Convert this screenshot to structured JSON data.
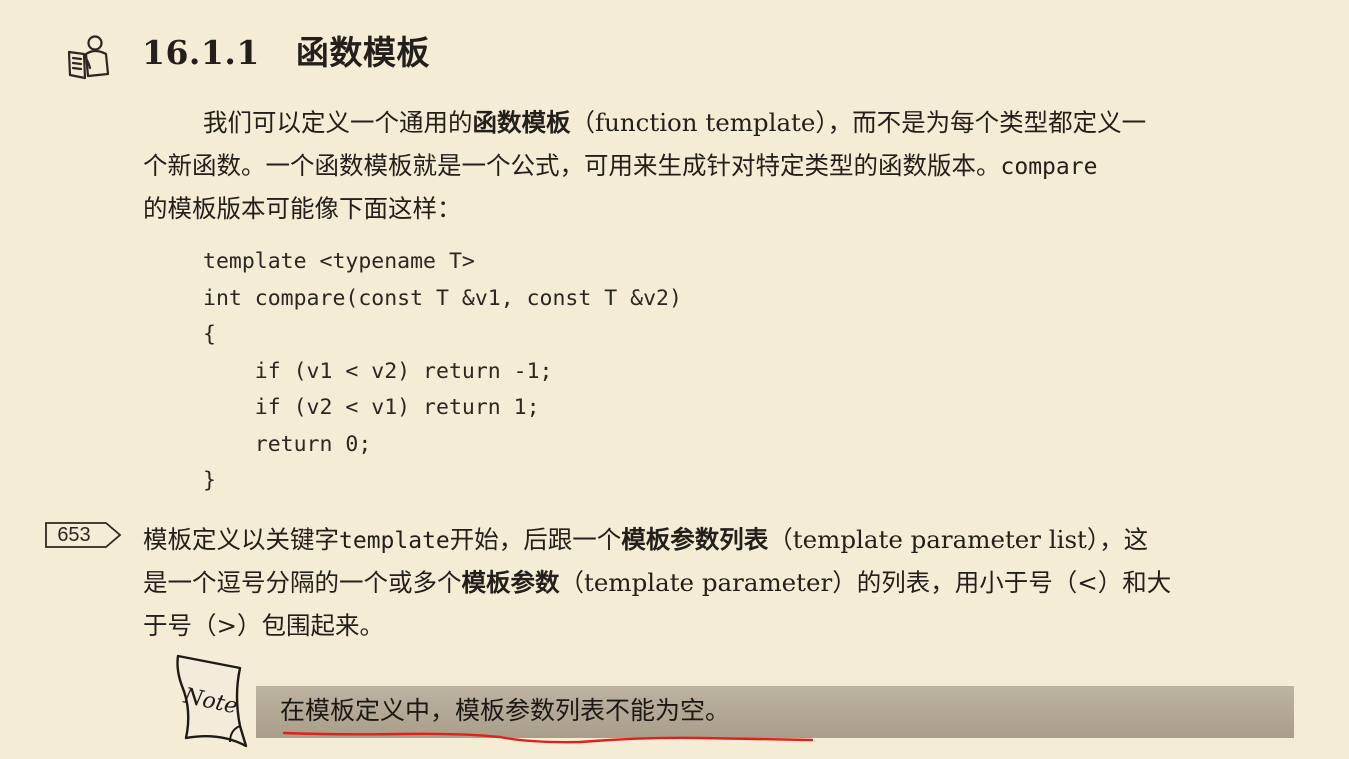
{
  "section": {
    "number": "16.1.1",
    "title": "函数模板",
    "icon": "reading-person-icon"
  },
  "para1": {
    "l1_a": "我们可以定义一个通用的",
    "l1_b": "函数模板",
    "l1_c": "（function template），而不是为每个类型都定义一",
    "l2_a": "个新函数。一个函数模板就是一个公式，可用来生成针对特定类型的函数版本。",
    "l2_code": "compare",
    "l3": "的模板版本可能像下面这样："
  },
  "code": {
    "lines": [
      "template <typename T>",
      "int compare(const T &v1, const T &v2)",
      "{",
      "    if (v1 < v2) return -1;",
      "    if (v2 < v1) return 1;",
      "    return 0;",
      "}"
    ]
  },
  "page_marker": "653",
  "para2": {
    "l1_a": "模板定义以关键字",
    "l1_code": "template",
    "l1_b": "开始，后跟一个",
    "l1_c": "模板参数列表",
    "l1_d": "（template parameter list），这",
    "l2_a": "是一个逗号分隔的一个或多个",
    "l2_b": "模板参数",
    "l2_c": "（template parameter）的列表，用小于号（<）和大",
    "l3": "于号（>）包围起来。"
  },
  "note": {
    "icon_label": "Note",
    "text": "在模板定义中，模板参数列表不能为空。",
    "underline_color": "#e0201b"
  },
  "colors": {
    "paper": "#f5ecd5",
    "note_band": "#b1a692",
    "ink": "#231f1a"
  }
}
